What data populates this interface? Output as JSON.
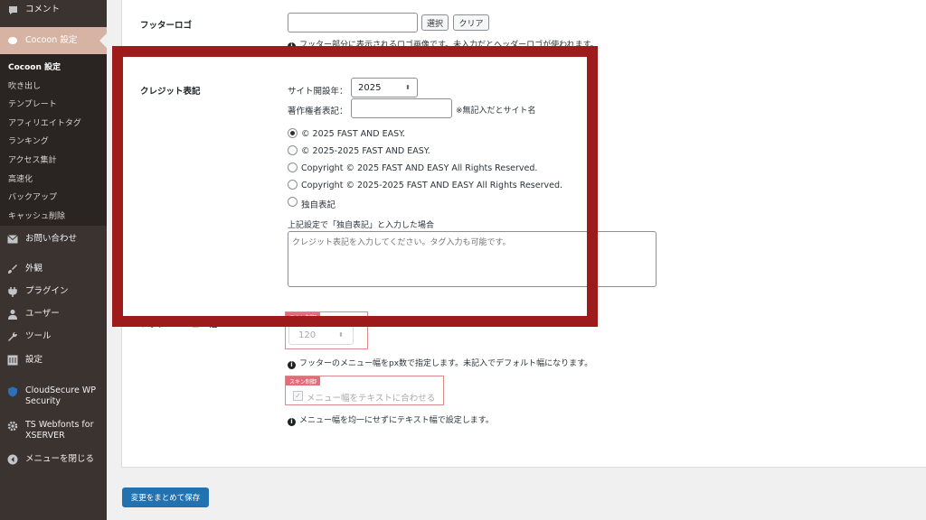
{
  "sidebar": {
    "comment": "コメント",
    "cocoon": "Cocoon 設定",
    "submenu": [
      "Cocoon 設定",
      "吹き出し",
      "テンプレート",
      "アフィリエイトタグ",
      "ランキング",
      "アクセス集計",
      "高速化",
      "バックアップ",
      "キャッシュ削除"
    ],
    "contact": "お問い合わせ",
    "appearance": "外観",
    "plugins": "プラグイン",
    "users": "ユーザー",
    "tools": "ツール",
    "settings": "設定",
    "cloudsecure": "CloudSecure WP Security",
    "tswebfonts": "TS Webfonts for XSERVER",
    "collapse": "メニューを閉じる"
  },
  "footer_logo": {
    "label": "フッターロゴ",
    "select_button": "選択",
    "clear_button": "クリア",
    "note": "フッター部分に表示されるロゴ画像です。未入力だとヘッダーロゴが使われます。"
  },
  "credit": {
    "label": "クレジット表記",
    "start_year_label": "サイト開設年：",
    "start_year_value": "2025",
    "copyright_label": "著作権者表記：",
    "copyright_value": "",
    "copyright_note": "※無記入だとサイト名",
    "options": [
      "© 2025 FAST AND EASY.",
      "© 2025-2025 FAST AND EASY.",
      "Copyright © 2025 FAST AND EASY All Rights Reserved.",
      "Copyright © 2025-2025 FAST AND EASY All Rights Reserved.",
      "独自表記"
    ],
    "custom_label": "上記設定で「独自表記」と入力した場合",
    "custom_placeholder": "クレジット表記を入力してください。タグ入力も可能です。"
  },
  "footer_menu": {
    "label": "フッターメニュー幅",
    "skin_tag": "スキン制御",
    "width_value": "120",
    "width_note": "フッターのメニュー幅をpx数で指定します。未記入でデフォルト幅になります。",
    "fit_text_label": "メニュー幅をテキストに合わせる",
    "fit_text_note": "メニュー幅を均一にせずにテキスト幅で設定します。"
  },
  "save_label": "変更をまとめて保存",
  "colors": {
    "highlight": "#9e1b1b",
    "accent": "#2271b1",
    "skin_tag": "#e46c7a"
  }
}
